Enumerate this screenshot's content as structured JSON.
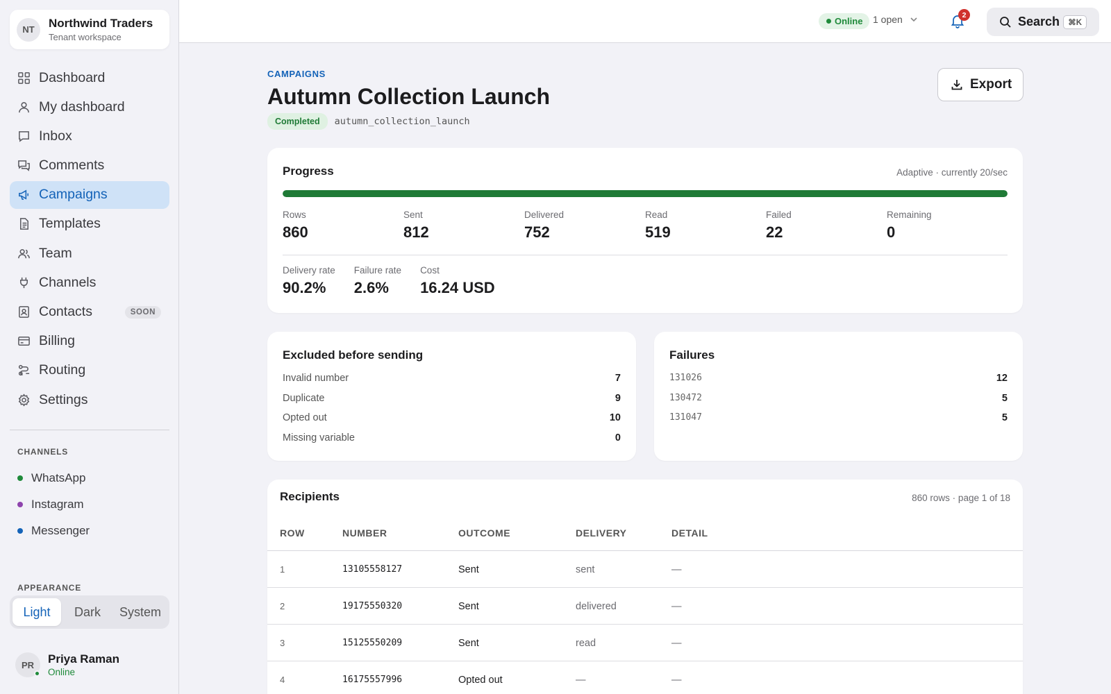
{
  "tenant": {
    "initials": "NT",
    "name": "Northwind Traders",
    "subtitle": "Tenant workspace"
  },
  "nav": [
    {
      "label": "Dashboard",
      "icon": "grid-icon"
    },
    {
      "label": "My dashboard",
      "icon": "user-icon"
    },
    {
      "label": "Inbox",
      "icon": "chat-icon"
    },
    {
      "label": "Comments",
      "icon": "comments-icon"
    },
    {
      "label": "Campaigns",
      "icon": "megaphone-icon",
      "active": true
    },
    {
      "label": "Templates",
      "icon": "document-icon"
    },
    {
      "label": "Team",
      "icon": "team-icon"
    },
    {
      "label": "Channels",
      "icon": "plug-icon"
    },
    {
      "label": "Contacts",
      "icon": "contact-card-icon",
      "badge": "SOON"
    },
    {
      "label": "Billing",
      "icon": "credit-card-icon"
    },
    {
      "label": "Routing",
      "icon": "routing-icon"
    },
    {
      "label": "Settings",
      "icon": "gear-icon"
    }
  ],
  "channels_section": {
    "label": "CHANNELS",
    "items": [
      {
        "label": "WhatsApp",
        "color": "#1f8a3a"
      },
      {
        "label": "Instagram",
        "color": "#8e44ad"
      },
      {
        "label": "Messenger",
        "color": "#1463b8"
      }
    ]
  },
  "appearance": {
    "label": "APPEARANCE",
    "options": [
      "Light",
      "Dark",
      "System"
    ],
    "selected": "Light"
  },
  "user": {
    "initials": "PR",
    "name": "Priya Raman",
    "status": "Online"
  },
  "topbar": {
    "status": "Online",
    "open_count": "1 open",
    "notifications": "2",
    "search_label": "Search",
    "search_shortcut": "⌘K"
  },
  "header": {
    "eyebrow": "CAMPAIGNS",
    "title": "Autumn Collection Launch",
    "status": "Completed",
    "slug": "autumn_collection_launch",
    "export_label": "Export"
  },
  "progress": {
    "title": "Progress",
    "rate_note": "Adaptive · currently 20/sec",
    "percent": 100,
    "stats": [
      {
        "label": "Rows",
        "value": "860"
      },
      {
        "label": "Sent",
        "value": "812"
      },
      {
        "label": "Delivered",
        "value": "752"
      },
      {
        "label": "Read",
        "value": "519"
      },
      {
        "label": "Failed",
        "value": "22"
      },
      {
        "label": "Remaining",
        "value": "0"
      }
    ],
    "summary": [
      {
        "label": "Delivery rate",
        "value": "90.2%"
      },
      {
        "label": "Failure rate",
        "value": "2.6%"
      },
      {
        "label": "Cost",
        "value": "16.24 USD"
      }
    ]
  },
  "excluded": {
    "title": "Excluded before sending",
    "items": [
      {
        "label": "Invalid number",
        "value": "7"
      },
      {
        "label": "Duplicate",
        "value": "9"
      },
      {
        "label": "Opted out",
        "value": "10"
      },
      {
        "label": "Missing variable",
        "value": "0"
      }
    ]
  },
  "failures": {
    "title": "Failures",
    "items": [
      {
        "label": "131026",
        "value": "12"
      },
      {
        "label": "130472",
        "value": "5"
      },
      {
        "label": "131047",
        "value": "5"
      }
    ]
  },
  "recipients": {
    "title": "Recipients",
    "meta": "860 rows · page 1 of 18",
    "columns": [
      "ROW",
      "NUMBER",
      "OUTCOME",
      "DELIVERY",
      "DETAIL"
    ],
    "rows": [
      {
        "row": "1",
        "number": "13105558127",
        "outcome": "Sent",
        "delivery": "sent",
        "detail": "—"
      },
      {
        "row": "2",
        "number": "19175550320",
        "outcome": "Sent",
        "delivery": "delivered",
        "detail": "—"
      },
      {
        "row": "3",
        "number": "15125550209",
        "outcome": "Sent",
        "delivery": "read",
        "detail": "—"
      },
      {
        "row": "4",
        "number": "16175557996",
        "outcome": "Opted out",
        "delivery": "—",
        "detail": "—"
      }
    ]
  }
}
